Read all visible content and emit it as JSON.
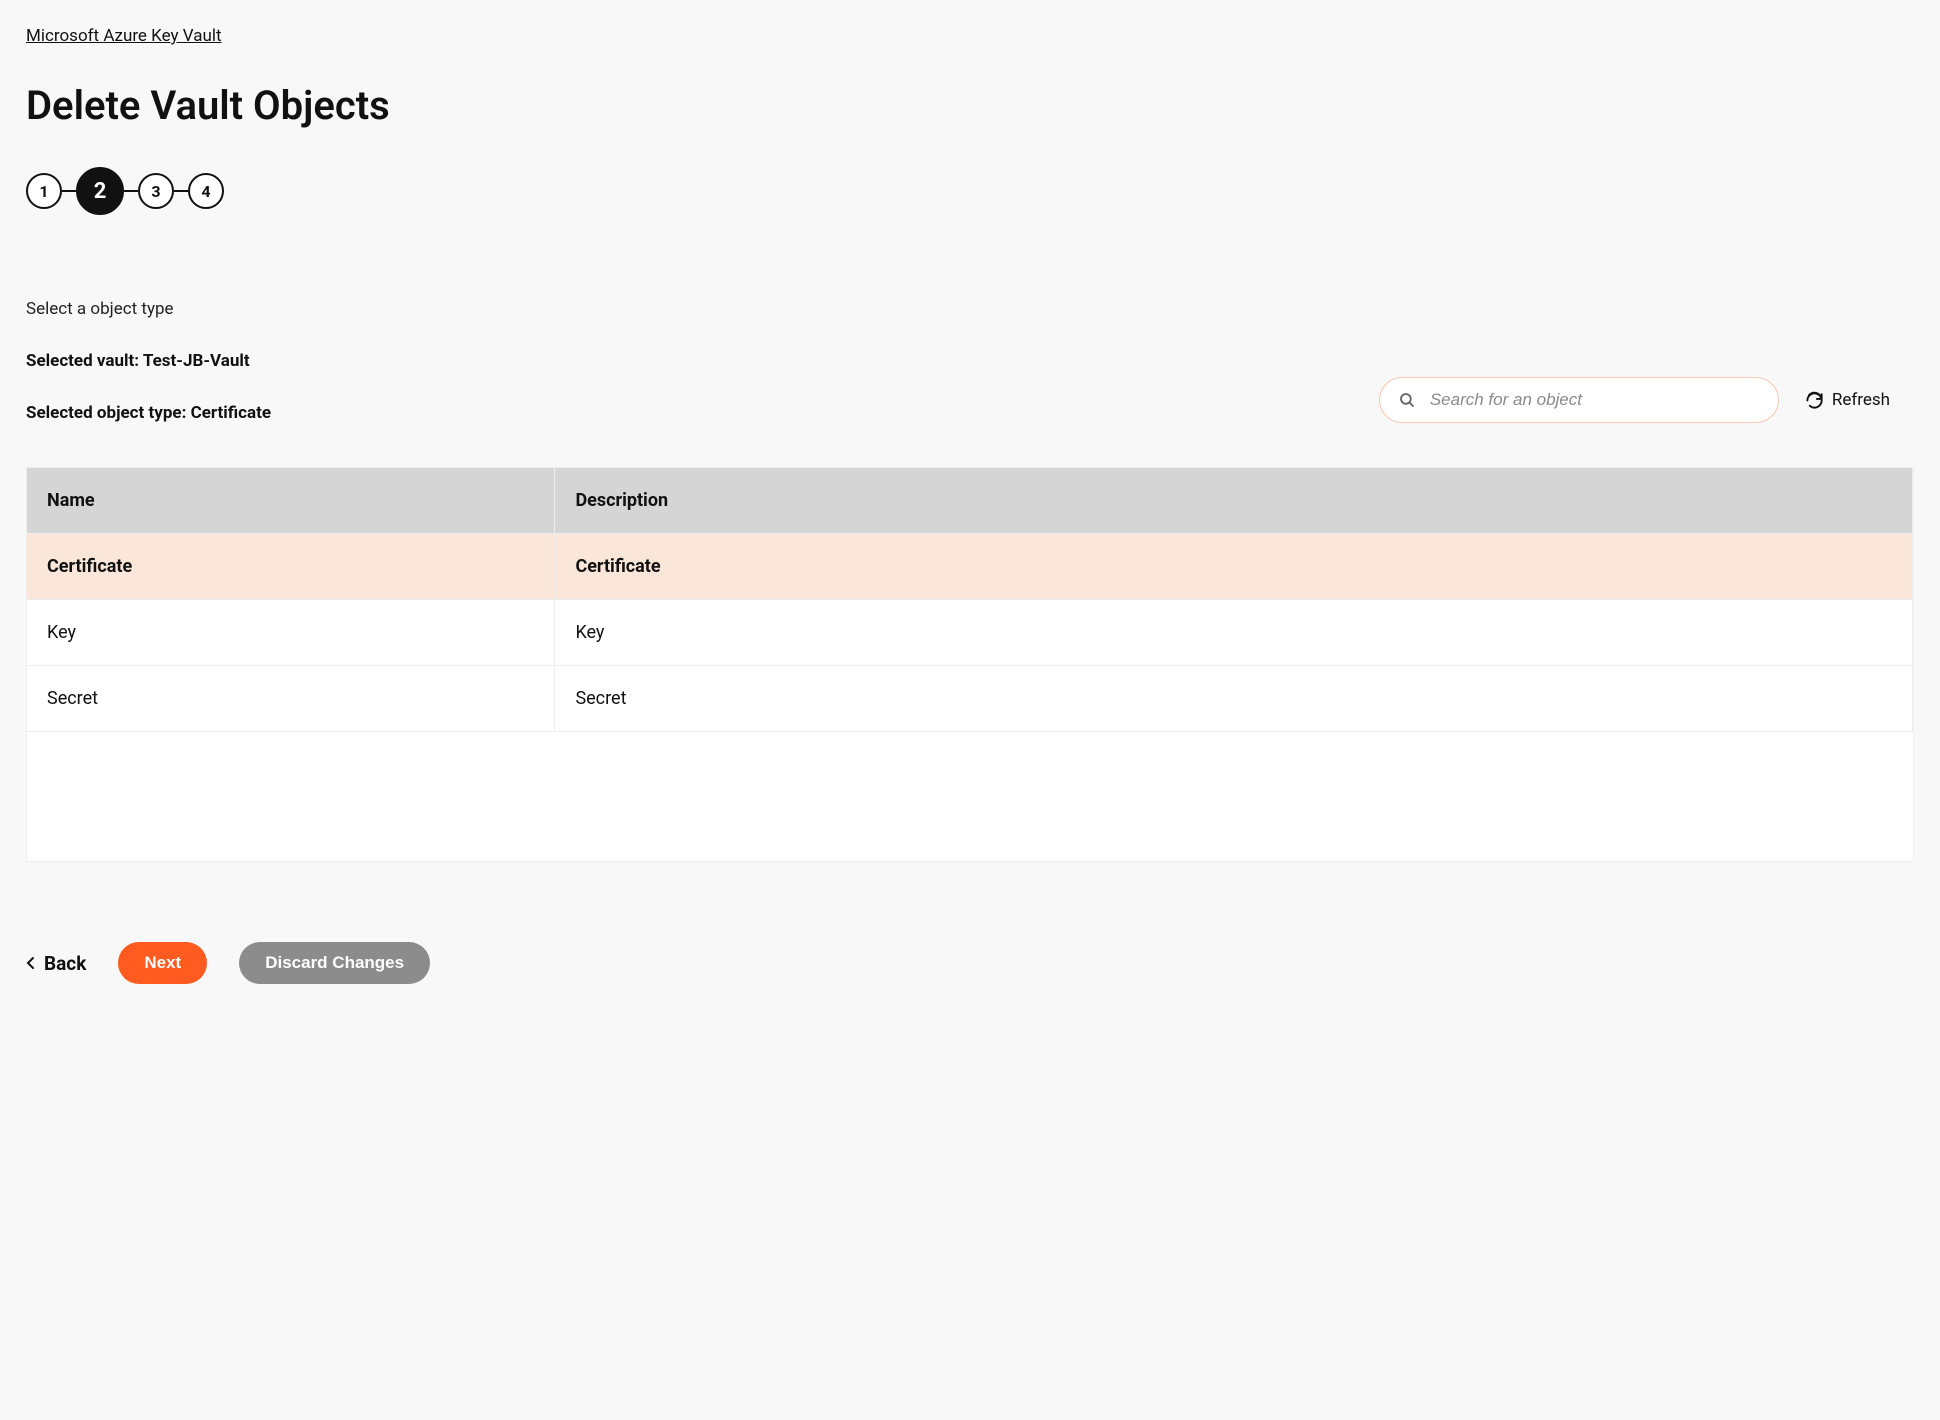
{
  "breadcrumb": "Microsoft Azure Key Vault",
  "page_title": "Delete Vault Objects",
  "stepper": {
    "steps": [
      "1",
      "2",
      "3",
      "4"
    ],
    "active_index": 1
  },
  "section_label": "Select a object type",
  "selected_vault_label": "Selected vault: Test-JB-Vault",
  "selected_type_label": "Selected object type: Certificate",
  "search": {
    "placeholder": "Search for an object",
    "value": ""
  },
  "refresh_label": "Refresh",
  "table": {
    "columns": [
      "Name",
      "Description"
    ],
    "rows": [
      {
        "name": "Certificate",
        "description": "Certificate",
        "selected": true
      },
      {
        "name": "Key",
        "description": "Key",
        "selected": false
      },
      {
        "name": "Secret",
        "description": "Secret",
        "selected": false
      }
    ]
  },
  "footer": {
    "back": "Back",
    "next": "Next",
    "discard": "Discard Changes"
  }
}
